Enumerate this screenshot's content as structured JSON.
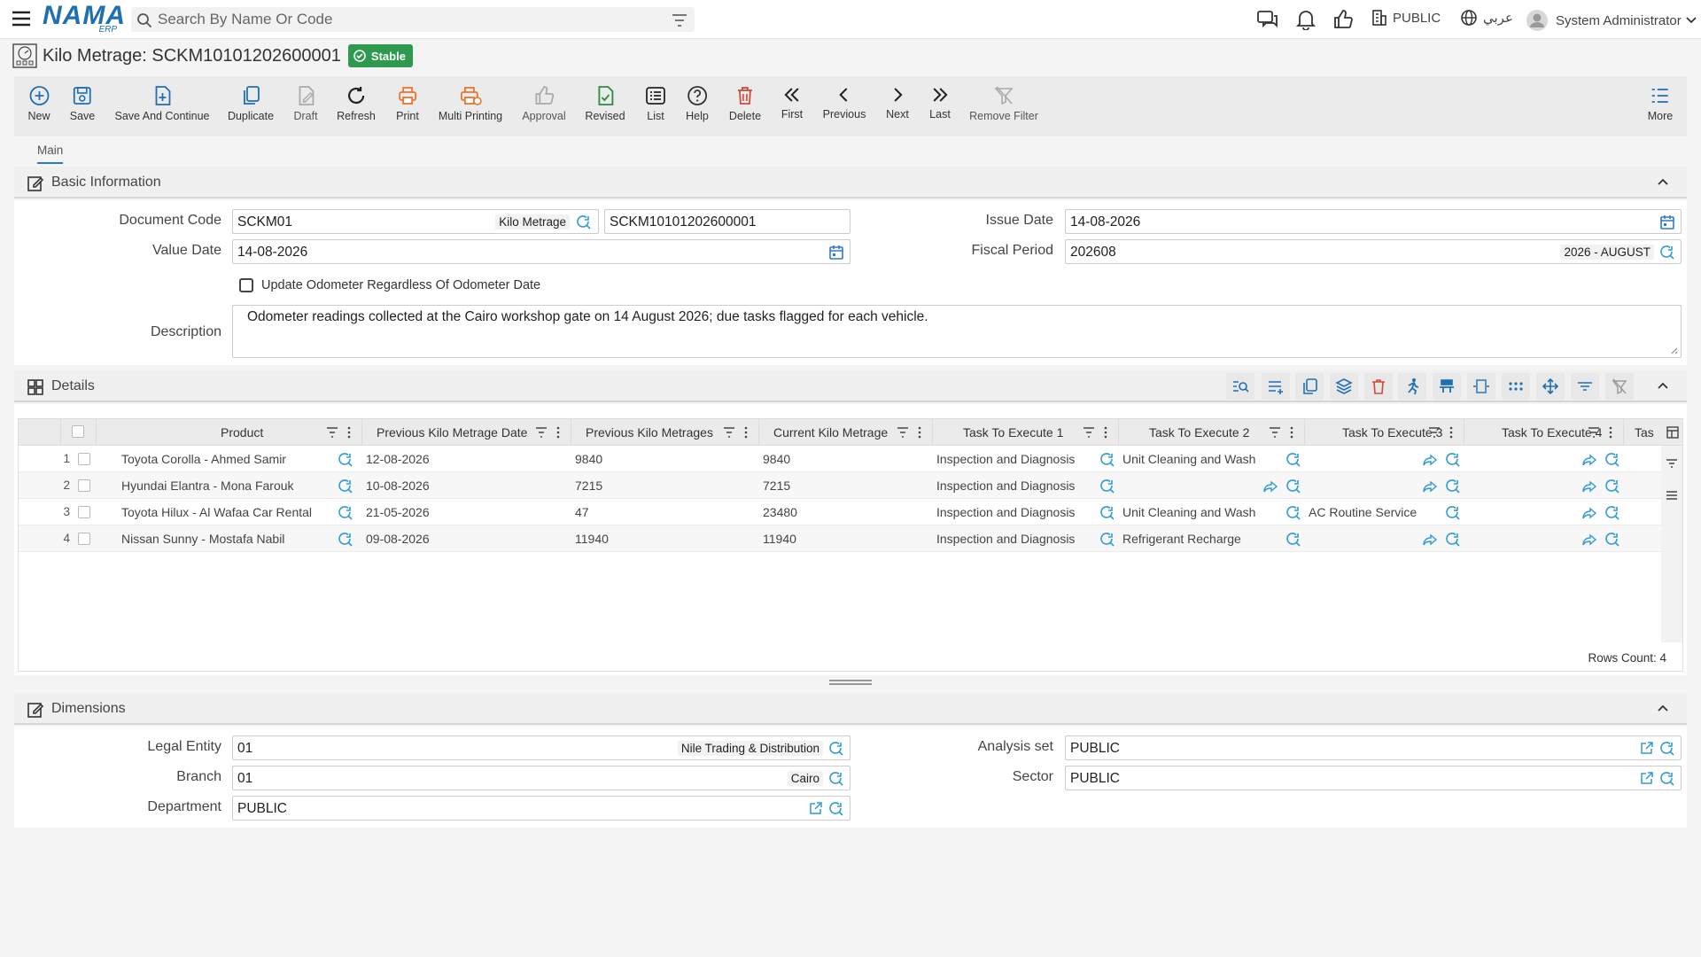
{
  "app": {
    "logo_main": "NAMA",
    "logo_sub": "ERP",
    "search_placeholder": "Search By Name Or Code",
    "org_label": "PUBLIC",
    "language_label": "عربي",
    "user_name": "System Administrator"
  },
  "page": {
    "title": "Kilo Metrage: SCKM10101202600001",
    "status": "Stable"
  },
  "toolbar": [
    {
      "label": "New",
      "icon": "plus-circle-icon",
      "enabled": true
    },
    {
      "label": "Save",
      "icon": "save-icon",
      "enabled": true
    },
    {
      "label": "Save And Continue",
      "icon": "save-continue-icon",
      "enabled": true
    },
    {
      "label": "Duplicate",
      "icon": "duplicate-icon",
      "enabled": true
    },
    {
      "label": "Draft",
      "icon": "draft-icon",
      "enabled": false
    },
    {
      "label": "Refresh",
      "icon": "refresh-icon",
      "enabled": true
    },
    {
      "label": "Print",
      "icon": "print-icon",
      "enabled": true
    },
    {
      "label": "Multi Printing",
      "icon": "multi-print-icon",
      "enabled": true
    },
    {
      "label": "Approval",
      "icon": "thumbs-up-icon",
      "enabled": false
    },
    {
      "label": "Revised",
      "icon": "revised-icon",
      "enabled": true
    },
    {
      "label": "List",
      "icon": "list-icon",
      "enabled": true
    },
    {
      "label": "Help",
      "icon": "help-icon",
      "enabled": true
    },
    {
      "label": "Delete",
      "icon": "trash-icon",
      "enabled": true
    },
    {
      "label": "First",
      "icon": "chevrons-left-icon",
      "enabled": true
    },
    {
      "label": "Previous",
      "icon": "chevron-left-icon",
      "enabled": true
    },
    {
      "label": "Next",
      "icon": "chevron-right-icon",
      "enabled": true
    },
    {
      "label": "Last",
      "icon": "chevrons-right-icon",
      "enabled": true
    },
    {
      "label": "Remove Filter",
      "icon": "remove-filter-icon",
      "enabled": false
    },
    {
      "label": "More",
      "icon": "more-list-icon",
      "enabled": true
    }
  ],
  "tabs": [
    {
      "label": "Main",
      "active": true
    }
  ],
  "basic": {
    "section_title": "Basic Information",
    "document_code_label": "Document Code",
    "document_code_value": "SCKM01",
    "document_code_tag": "Kilo Metrage",
    "document_number": "SCKM10101202600001",
    "issue_date_label": "Issue Date",
    "issue_date_value": "14-08-2026",
    "value_date_label": "Value Date",
    "value_date_value": "14-08-2026",
    "fiscal_period_label": "Fiscal Period",
    "fiscal_period_value": "202608",
    "fiscal_period_tag": "2026 - AUGUST",
    "update_odometer_label": "Update Odometer Regardless Of Odometer Date",
    "description_label": "Description",
    "description_value": "Odometer readings collected at the Cairo workshop gate on 14 August 2026; due tasks flagged for each vehicle."
  },
  "details": {
    "section_title": "Details",
    "columns": [
      "Product",
      "Previous Kilo Metrage Date",
      "Previous Kilo Metrages",
      "Current Kilo Metrage",
      "Task To Execute 1",
      "Task To Execute 2",
      "Task To Execute 3",
      "Task To Execute 4",
      "Tas"
    ],
    "rows": [
      {
        "num": "1",
        "product": "Toyota Corolla - Ahmed Samir",
        "prev_date": "12-08-2026",
        "prev_km": "9840",
        "curr_km": "9840",
        "task1": "Inspection and Diagnosis",
        "task2": "Unit Cleaning and Wash",
        "task3": "",
        "task4": ""
      },
      {
        "num": "2",
        "product": "Hyundai Elantra - Mona Farouk",
        "prev_date": "10-08-2026",
        "prev_km": "7215",
        "curr_km": "7215",
        "task1": "Inspection and Diagnosis",
        "task2": "",
        "task3": "",
        "task4": ""
      },
      {
        "num": "3",
        "product": "Toyota Hilux - Al Wafaa Car Rental",
        "prev_date": "21-05-2026",
        "prev_km": "47",
        "curr_km": "23480",
        "task1": "Inspection and Diagnosis",
        "task2": "Unit Cleaning and Wash",
        "task3": "AC Routine Service",
        "task4": ""
      },
      {
        "num": "4",
        "product": "Nissan Sunny - Mostafa Nabil",
        "prev_date": "09-08-2026",
        "prev_km": "11940",
        "curr_km": "11940",
        "task1": "Inspection and Diagnosis",
        "task2": "Refrigerant Recharge",
        "task3": "",
        "task4": ""
      }
    ],
    "rows_count": "Rows Count: 4"
  },
  "dimensions": {
    "section_title": "Dimensions",
    "legal_entity_label": "Legal Entity",
    "legal_entity_value": "01",
    "legal_entity_tag": "Nile Trading & Distribution",
    "branch_label": "Branch",
    "branch_value": "01",
    "branch_tag": "Cairo",
    "department_label": "Department",
    "department_value": "PUBLIC",
    "analysis_set_label": "Analysis set",
    "analysis_set_value": "PUBLIC",
    "sector_label": "Sector",
    "sector_value": "PUBLIC"
  },
  "colors": {
    "accent": "#1f6fb5",
    "status_green": "#2e9a4f",
    "print_orange": "#e8752c",
    "delete_red": "#d04a3b"
  }
}
